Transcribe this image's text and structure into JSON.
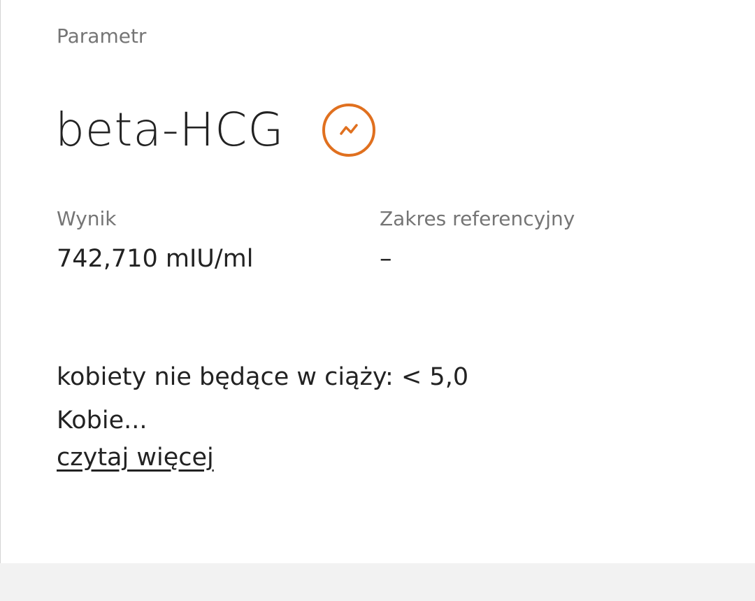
{
  "section": {
    "label": "Parametr"
  },
  "parameter": {
    "name": "beta-HCG",
    "trend_icon": "trend-line-icon",
    "accent_color": "#e0701f"
  },
  "result": {
    "label": "Wynik",
    "value": "742,710 mIU/ml"
  },
  "reference": {
    "label": "Zakres referencyjny",
    "value": "–"
  },
  "description": {
    "line1": "kobiety nie będące w ciąży: < 5,0",
    "line2": "Kobie...",
    "read_more": "czytaj więcej"
  }
}
